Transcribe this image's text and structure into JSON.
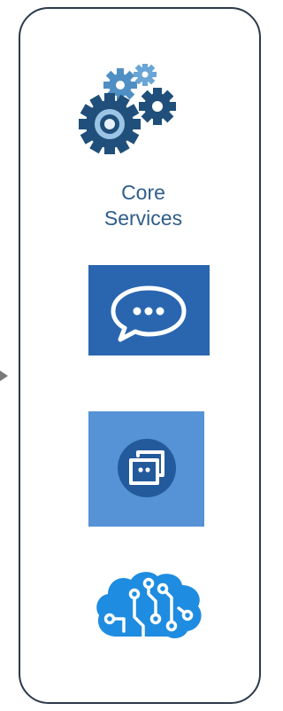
{
  "panel": {
    "items": [
      {
        "icon": "gears-icon",
        "label_lines": [
          "Core",
          "Services"
        ]
      },
      {
        "icon": "chat-bubble-icon"
      },
      {
        "icon": "bot-service-icon"
      },
      {
        "icon": "cognitive-brain-icon"
      }
    ]
  },
  "colors": {
    "panel_border": "#2b3a4a",
    "label_text": "#2f5d8a",
    "chat_tile": "#2a66b0",
    "bot_tile": "#5592d6",
    "bot_circle": "#235a9c",
    "gear_dark": "#1f4f7a",
    "gear_light": "#4f8fc4",
    "brain": "#1e8ce0",
    "arrow": "#7a7a7a"
  }
}
